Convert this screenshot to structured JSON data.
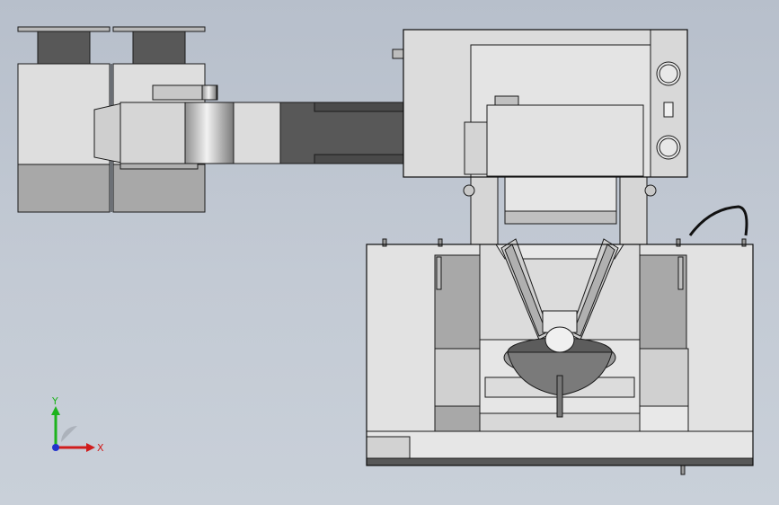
{
  "viewport": {
    "background_top": "#b7bfcb",
    "background_bottom": "#c9d0d9"
  },
  "model": {
    "part_fill_light": "#dcdcdc",
    "part_fill_mid": "#a9a9a9",
    "part_fill_dark": "#5a5a5a",
    "edge_color": "#1a1a1a"
  },
  "triad": {
    "y_label": "Y",
    "x_label": "X",
    "y_color": "#1db31d",
    "x_color": "#d01c1c",
    "z_color": "#2233cc"
  }
}
